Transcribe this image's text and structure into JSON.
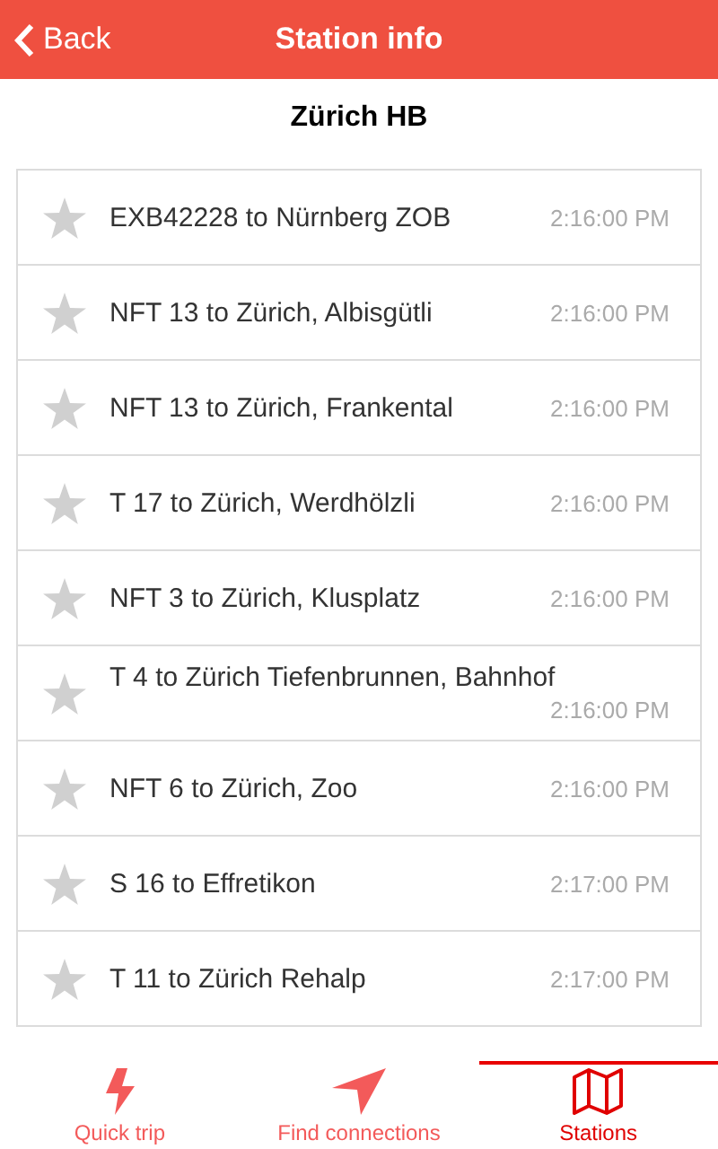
{
  "header": {
    "back": "Back",
    "title": "Station info"
  },
  "station": "Zürich HB",
  "departures": [
    {
      "line": "EXB42228 to Nürnberg ZOB",
      "time": "2:16:00 PM",
      "starred": false
    },
    {
      "line": "NFT 13 to Zürich, Albisgütli",
      "time": "2:16:00 PM",
      "starred": false
    },
    {
      "line": "NFT 13 to Zürich, Frankental",
      "time": "2:16:00 PM",
      "starred": false
    },
    {
      "line": "T 17 to Zürich, Werdhölzli",
      "time": "2:16:00 PM",
      "starred": false
    },
    {
      "line": "NFT 3 to Zürich, Klusplatz",
      "time": "2:16:00 PM",
      "starred": false
    },
    {
      "line": "T 4 to Zürich Tiefenbrunnen, Bahnhof",
      "time": "2:16:00 PM",
      "starred": false
    },
    {
      "line": "NFT 6 to Zürich, Zoo",
      "time": "2:16:00 PM",
      "starred": false
    },
    {
      "line": "S 16 to Effretikon",
      "time": "2:17:00 PM",
      "starred": false
    },
    {
      "line": "T 11 to Zürich Rehalp",
      "time": "2:17:00 PM",
      "starred": false
    }
  ],
  "tabs": [
    {
      "kind": "bolt",
      "label": "Quick trip",
      "selected": false
    },
    {
      "kind": "arrow",
      "label": "Find connections",
      "selected": false
    },
    {
      "kind": "map",
      "label": "Stations",
      "selected": true
    }
  ]
}
